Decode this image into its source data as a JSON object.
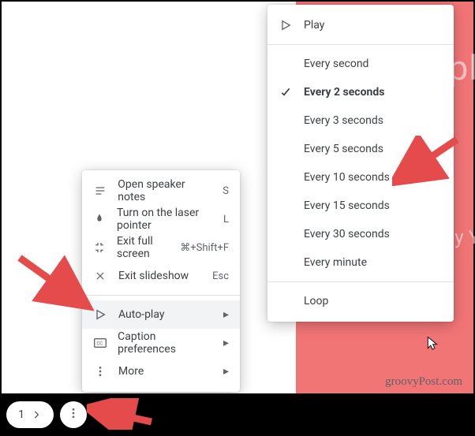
{
  "slide": {
    "text_top": "Simpl",
    "text_mid": "By Y"
  },
  "toolbar": {
    "page": "1"
  },
  "menu1": {
    "speaker_notes": "Open speaker notes",
    "speaker_notes_key": "S",
    "laser": "Turn on the laser pointer",
    "laser_key": "L",
    "exit_fs": "Exit full screen",
    "exit_fs_key": "⌘+Shift+F",
    "exit_show": "Exit slideshow",
    "exit_show_key": "Esc",
    "autoplay": "Auto-play",
    "captions": "Caption preferences",
    "more": "More"
  },
  "menu2": {
    "play": "Play",
    "opt1": "Every second",
    "opt2": "Every 2 seconds",
    "opt3": "Every 3 seconds",
    "opt4": "Every 5 seconds",
    "opt5": "Every 10 seconds",
    "opt6": "Every 15 seconds",
    "opt7": "Every 30 seconds",
    "opt8": "Every minute",
    "loop": "Loop"
  },
  "watermark": "groovyPost.com"
}
